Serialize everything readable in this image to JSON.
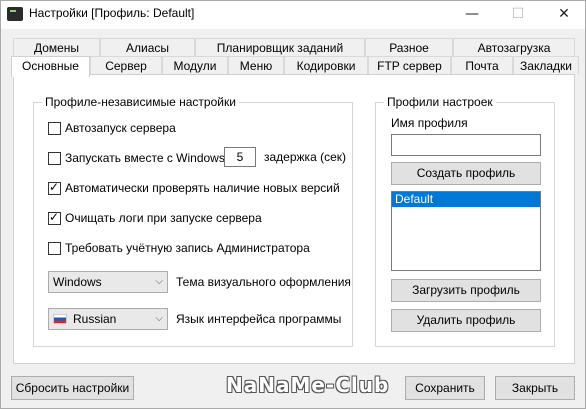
{
  "window": {
    "title": "Настройки [Профиль: Default]",
    "minimize": "—",
    "maximize": "☐",
    "close": "✕"
  },
  "tabs_row1": [
    {
      "label": "Домены"
    },
    {
      "label": "Алиасы"
    },
    {
      "label": "Планировщик заданий"
    },
    {
      "label": "Разное"
    },
    {
      "label": "Автозагрузка"
    }
  ],
  "tabs_row2": [
    {
      "label": "Основные",
      "active": true
    },
    {
      "label": "Сервер"
    },
    {
      "label": "Модули"
    },
    {
      "label": "Меню"
    },
    {
      "label": "Кодировки"
    },
    {
      "label": "FTP сервер"
    },
    {
      "label": "Почта"
    },
    {
      "label": "Закладки"
    }
  ],
  "general": {
    "group_title": "Профиле-независимые настройки",
    "autostart": {
      "label": "Автозапуск сервера",
      "checked": false
    },
    "start_with_windows": {
      "label": "Запускать вместе с Windows",
      "checked": false
    },
    "delay_value": "5",
    "delay_label": "задержка (сек)",
    "check_updates": {
      "label": "Автоматически проверять наличие новых версий",
      "checked": true
    },
    "clear_logs": {
      "label": "Очищать логи при запуске сервера",
      "checked": true
    },
    "require_admin": {
      "label": "Требовать учётную запись Администратора",
      "checked": false
    },
    "theme_select": "Windows",
    "theme_label": "Тема визуального оформления",
    "language_select": "Russian",
    "language_label": "Язык интерфейса программы"
  },
  "profiles": {
    "group_title": "Профили настроек",
    "name_label": "Имя профиля",
    "name_value": "",
    "create_button": "Создать профиль",
    "list": [
      "Default"
    ],
    "load_button": "Загрузить профиль",
    "delete_button": "Удалить профиль"
  },
  "footer": {
    "reset_button": "Сбросить настройки",
    "save_button": "Сохранить",
    "close_button": "Закрыть",
    "watermark": "NaNaMe-Club"
  }
}
